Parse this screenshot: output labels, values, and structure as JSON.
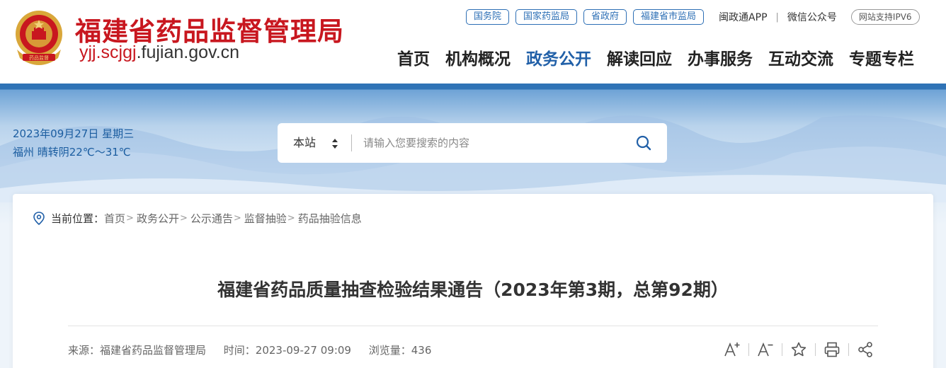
{
  "header": {
    "site_title": "福建省药品监督管理局",
    "domain_part1": "yjj.scjgj",
    "domain_part2": ".fujian.gov.cn",
    "emblem_label": "药品监督"
  },
  "top_links": [
    "国务院",
    "国家药监局",
    "省政府",
    "福建省市监局"
  ],
  "top_texts": {
    "app": "闽政通APP",
    "sep": "|",
    "wechat": "微信公众号",
    "ipv6": "网站支持IPV6"
  },
  "nav": [
    {
      "label": "首页"
    },
    {
      "label": "机构概况"
    },
    {
      "label": "政务公开",
      "active": true
    },
    {
      "label": "解读回应"
    },
    {
      "label": "办事服务"
    },
    {
      "label": "互动交流"
    },
    {
      "label": "专题专栏"
    }
  ],
  "date_weather": {
    "date": "2023年09月27日 星期三",
    "weather": "福州 晴转阴22℃～31℃"
  },
  "search": {
    "scope": "本站",
    "placeholder": "请输入您要搜索的内容"
  },
  "breadcrumb": {
    "label": "当前位置：",
    "items": [
      "首页",
      "政务公开",
      "公示通告",
      "监督抽验",
      "药品抽验信息"
    ],
    "separator": ">"
  },
  "article": {
    "title": "福建省药品质量抽查检验结果通告（2023年第3期，总第92期）",
    "source": "来源：福建省药品监督管理局",
    "time": "时间：2023-09-27 09:09",
    "views": "浏览量：436"
  },
  "colors": {
    "brand_red": "#c8171f",
    "nav_active": "#2160a8",
    "link_blue": "#2d6fb5"
  },
  "icons": [
    "location-icon",
    "font-increase-icon",
    "font-decrease-icon",
    "star-icon",
    "print-icon",
    "share-icon",
    "search-icon",
    "national-emblem-icon"
  ]
}
